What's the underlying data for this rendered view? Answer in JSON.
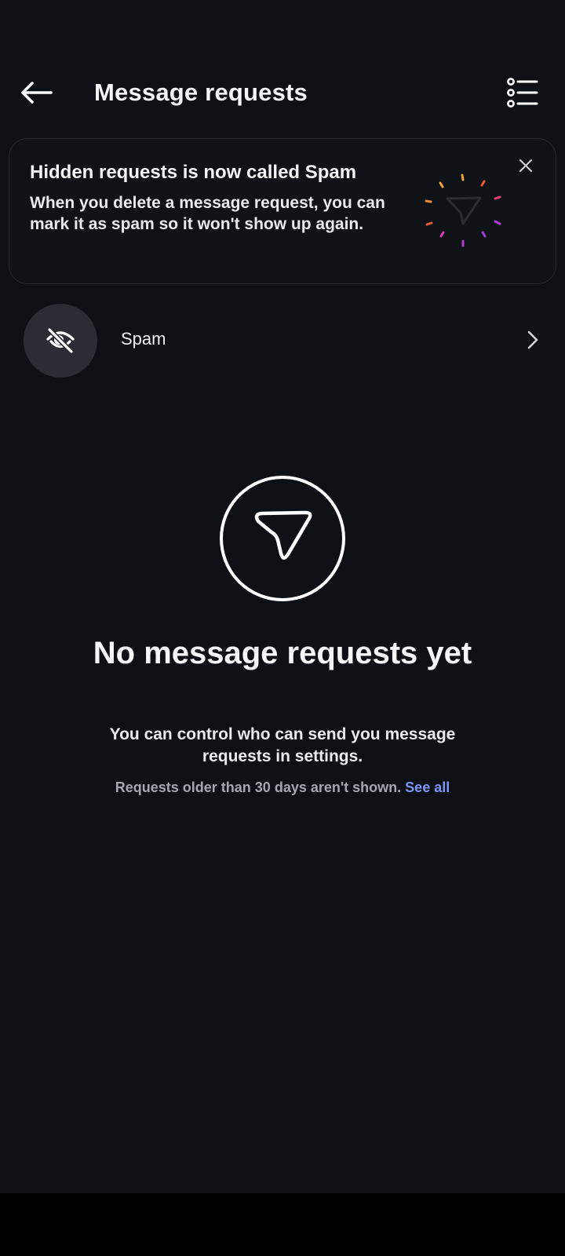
{
  "header": {
    "title": "Message requests",
    "back_icon": "arrow-left-icon",
    "list_icon": "list-options-icon"
  },
  "banner": {
    "title": "Hidden requests is now called Spam",
    "body": "When you delete a message request, you can mark it as spam so it won't show up again.",
    "close_icon": "close-icon",
    "art_icon": "send-burst-icon"
  },
  "spam": {
    "label": "Spam",
    "icon": "eye-slash-icon",
    "chevron_icon": "chevron-right-icon"
  },
  "empty_state": {
    "icon": "send-circle-icon",
    "title": "No message requests yet",
    "subtitle": "You can control who can send you message requests in settings.",
    "note": "Requests older than 30 days aren't shown.",
    "link": "See all"
  },
  "colors": {
    "background": "#0d1015",
    "link": "#7f95f6",
    "muted_text": "#a3a7af",
    "avatar_bg": "#2a2d33"
  }
}
